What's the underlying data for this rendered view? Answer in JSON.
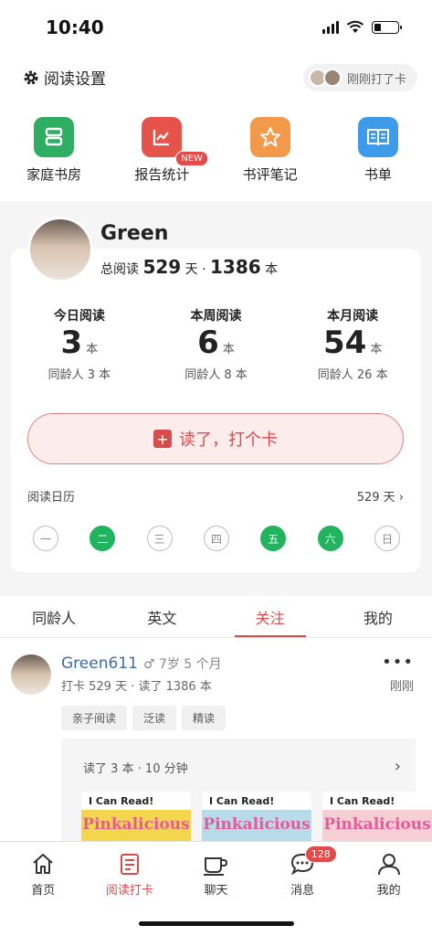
{
  "status": {
    "time": "10:40"
  },
  "header": {
    "settings_label": "阅读设置",
    "checkin_pill": "刚刚打了卡"
  },
  "features": [
    {
      "label": "家庭书房",
      "color": "#2fae63",
      "icon": "bookshelf-icon"
    },
    {
      "label": "报告统计",
      "color": "#e5534b",
      "icon": "chart-icon",
      "badge": "NEW"
    },
    {
      "label": "书评笔记",
      "color": "#f2994a",
      "icon": "star-icon"
    },
    {
      "label": "书单",
      "color": "#3d9be9",
      "icon": "book-icon"
    }
  ],
  "profile": {
    "name": "Green",
    "total_prefix": "总阅读",
    "total_days": "529",
    "days_unit": "天",
    "sep": "·",
    "total_books": "1386",
    "books_unit": "本"
  },
  "stats": [
    {
      "label": "今日阅读",
      "value": "3",
      "unit": "本",
      "peer": "同龄人 3 本"
    },
    {
      "label": "本周阅读",
      "value": "6",
      "unit": "本",
      "peer": "同龄人 8 本"
    },
    {
      "label": "本月阅读",
      "value": "54",
      "unit": "本",
      "peer": "同龄人 26 本"
    }
  ],
  "checkin_button": "读了，打个卡",
  "calendar": {
    "label": "阅读日历",
    "days_count": "529 天",
    "chevron": "›",
    "days": [
      {
        "label": "一",
        "done": false
      },
      {
        "label": "二",
        "done": true
      },
      {
        "label": "三",
        "done": false
      },
      {
        "label": "四",
        "done": false
      },
      {
        "label": "五",
        "done": true
      },
      {
        "label": "六",
        "done": true
      },
      {
        "label": "日",
        "done": false
      }
    ]
  },
  "tabs": [
    "同龄人",
    "英文",
    "关注",
    "我的"
  ],
  "active_tab": 2,
  "post": {
    "user": "Green611",
    "age": "♂ 7岁 5 个月",
    "meta": "打卡 529 天 · 读了 1386 本",
    "time": "刚刚",
    "more": "•••",
    "tags": [
      "亲子阅读",
      "泛读",
      "精读"
    ],
    "record": "读了 3 本 · 10 分钟",
    "books": [
      {
        "series": "I Can Read!",
        "title": "Pinkalicious",
        "bg": "#f4d64e"
      },
      {
        "series": "I Can Read!",
        "title": "Pinkalicious",
        "bg": "#b7dbe9"
      },
      {
        "series": "I Can Read!",
        "title": "Pinkalicious",
        "bg": "#f6cfd4"
      }
    ]
  },
  "bottom_nav": [
    {
      "label": "首页",
      "icon": "home-icon"
    },
    {
      "label": "阅读打卡",
      "icon": "checkin-icon",
      "active": true
    },
    {
      "label": "聊天",
      "icon": "cup-icon"
    },
    {
      "label": "消息",
      "icon": "chat-bubble-icon",
      "badge": "128"
    },
    {
      "label": "我的",
      "icon": "person-icon"
    }
  ],
  "colors": {
    "accent": "#d84b4b",
    "green": "#22b35e"
  }
}
